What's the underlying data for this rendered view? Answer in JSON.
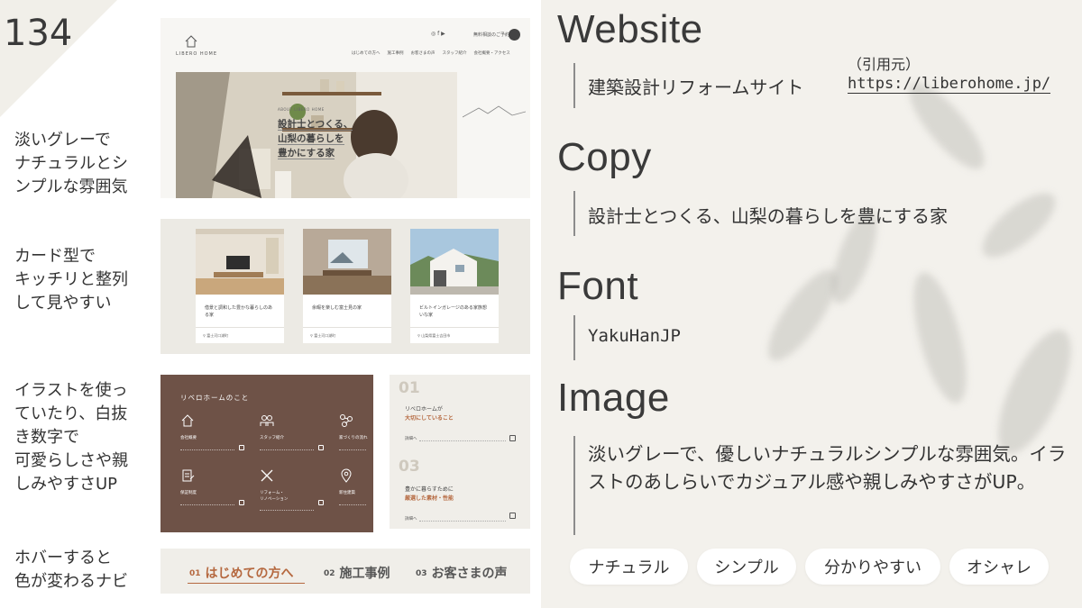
{
  "slide": {
    "number": "134"
  },
  "left_notes": [
    "淡いグレーで\nナチュラルとシ\nンプルな雰囲気",
    "カード型で\nキッチリと整列\nして見やすい",
    "イラストを使っ\nていたり、白抜\nき数字で\n可愛らしさや親\nしみやすさUP",
    "ホバーすると\n色が変わるナビ"
  ],
  "mock_site": {
    "logo": "LIBERO HOME",
    "top_cta": "無料相談のご予約",
    "nav": [
      "はじめての方へ",
      "施工事例",
      "お客さまの声",
      "スタッフ紹介",
      "会社概要・アクセス"
    ],
    "hero_about": "ABOUT LIBERO HOME",
    "hero_copy_lines": [
      "設計士とつくる、",
      "山梨の暮らしを",
      "豊かにする家"
    ]
  },
  "cards": [
    {
      "title": "借景と調和した豊かな暮らしのある家",
      "location": "富士河口湖町"
    },
    {
      "title": "余暇を楽しむ富士見の家",
      "location": "富士河口湖町"
    },
    {
      "title": "ビルトインガレージのある家族想いな家",
      "location": "山梨県富士吉田市"
    }
  ],
  "brown_panel": {
    "title": "リベロホームのこと",
    "items": [
      {
        "label": "会社概要",
        "icon": "house-icon"
      },
      {
        "label": "スタッフ紹介",
        "icon": "people-icon"
      },
      {
        "label": "家づくりの流れ",
        "icon": "flow-icon"
      },
      {
        "label": "保証制度",
        "icon": "document-icon"
      },
      {
        "label": "リフォーム・\nリノベーション",
        "icon": "tools-icon"
      },
      {
        "label": "新住建築",
        "icon": "location-icon"
      }
    ]
  },
  "numbered_panel": {
    "items": [
      {
        "number": "01",
        "line1": "リベロホームが",
        "line2": "大切にしていること",
        "more": "詳細へ"
      },
      {
        "number": "03",
        "line1": "豊かに暮らすために",
        "line2": "厳選した素材・性能",
        "more": "詳細へ"
      }
    ]
  },
  "nav_demo": {
    "items": [
      {
        "number": "01",
        "label": "はじめての方へ",
        "active": true
      },
      {
        "number": "02",
        "label": "施工事例",
        "active": false
      },
      {
        "number": "03",
        "label": "お客さまの声",
        "active": false
      }
    ]
  },
  "right": {
    "website_heading": "Website",
    "website_text": "建築設計リフォームサイト",
    "ref_label": "（引用元）",
    "ref_url": "https://liberohome.jp/",
    "copy_heading": "Copy",
    "copy_text": "設計士とつくる、山梨の暮らしを豊にする家",
    "font_heading": "Font",
    "font_text": "YakuHanJP",
    "image_heading": "Image",
    "image_text": "淡いグレーで、優しいナチュラルシンプルな雰囲気。イラストのあしらいでカジュアル感や親しみやすさがUP。",
    "tags": [
      "ナチュラル",
      "シンプル",
      "分かりやすい",
      "オシャレ"
    ]
  },
  "colors": {
    "accent": "#b5683f",
    "brown": "#6e5247",
    "panel_bg": "#f3f1ec"
  }
}
